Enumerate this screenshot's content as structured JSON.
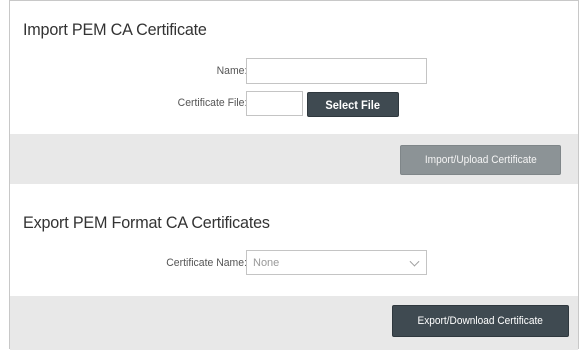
{
  "import_section": {
    "title": "Import PEM CA Certificate",
    "name_label": "Name:",
    "name_value": "",
    "file_label": "Certificate File:",
    "file_value": "",
    "select_file_label": "Select File",
    "import_button_label": "Import/Upload Certificate",
    "import_button_enabled": false
  },
  "export_section": {
    "title": "Export PEM Format CA Certificates",
    "cert_name_label": "Certificate Name:",
    "cert_name_selected": "None",
    "export_button_label": "Export/Download Certificate"
  },
  "colors": {
    "dark_button": "#3f4a51",
    "disabled_button": "#8c9396",
    "action_bar": "#e8e8e8",
    "border": "#c8c8c8"
  },
  "icons": {
    "select_chevron": "chevron-down-icon"
  }
}
